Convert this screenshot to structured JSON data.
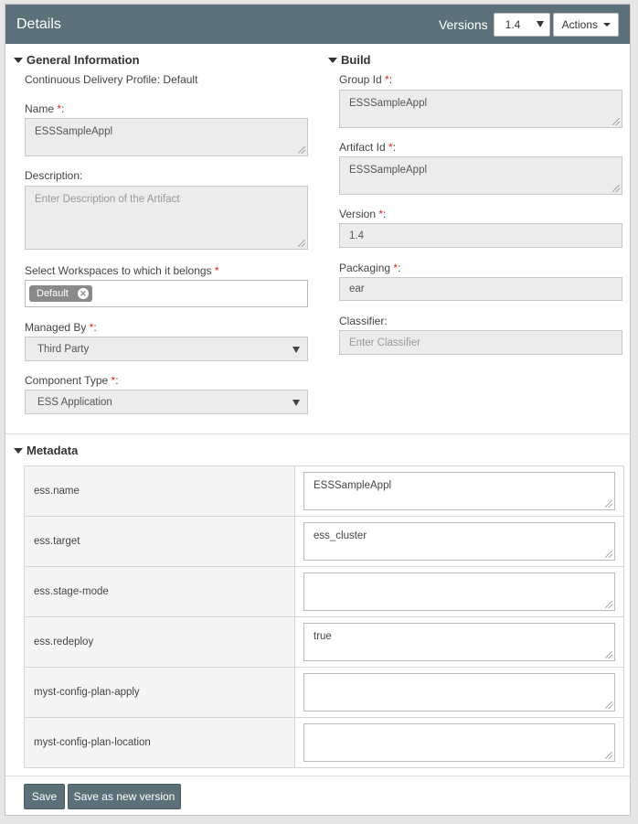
{
  "header": {
    "title": "Details",
    "versions_label": "Versions",
    "version_value": "1.4",
    "actions_label": "Actions"
  },
  "general": {
    "title": "General Information",
    "profile": "Continuous Delivery Profile: Default",
    "name_label": "Name",
    "name_value": "ESSSampleAppl",
    "description_label": "Description:",
    "description_placeholder": "Enter Description of the Artifact",
    "workspaces_label": "Select Workspaces to which it belongs",
    "workspace_tag": "Default",
    "managed_by_label": "Managed By",
    "managed_by_value": "Third Party",
    "component_type_label": "Component Type",
    "component_type_value": "ESS Application"
  },
  "build": {
    "title": "Build",
    "group_id_label": "Group Id",
    "group_id_value": "ESSSampleAppl",
    "artifact_id_label": "Artifact Id",
    "artifact_id_value": "ESSSampleAppl",
    "version_label": "Version",
    "version_value": "1.4",
    "packaging_label": "Packaging",
    "packaging_value": "ear",
    "classifier_label": "Classifier:",
    "classifier_placeholder": "Enter Classifier"
  },
  "metadata": {
    "title": "Metadata",
    "rows": [
      {
        "key": "ess.name",
        "value": "ESSSampleAppl"
      },
      {
        "key": "ess.target",
        "value": "ess_cluster"
      },
      {
        "key": "ess.stage-mode",
        "value": ""
      },
      {
        "key": "ess.redeploy",
        "value": "true"
      },
      {
        "key": "myst-config-plan-apply",
        "value": ""
      },
      {
        "key": "myst-config-plan-location",
        "value": ""
      }
    ]
  },
  "footer": {
    "save_label": "Save",
    "save_new_label": "Save as new version"
  },
  "required_mark": "*",
  "required_suffix": ":"
}
